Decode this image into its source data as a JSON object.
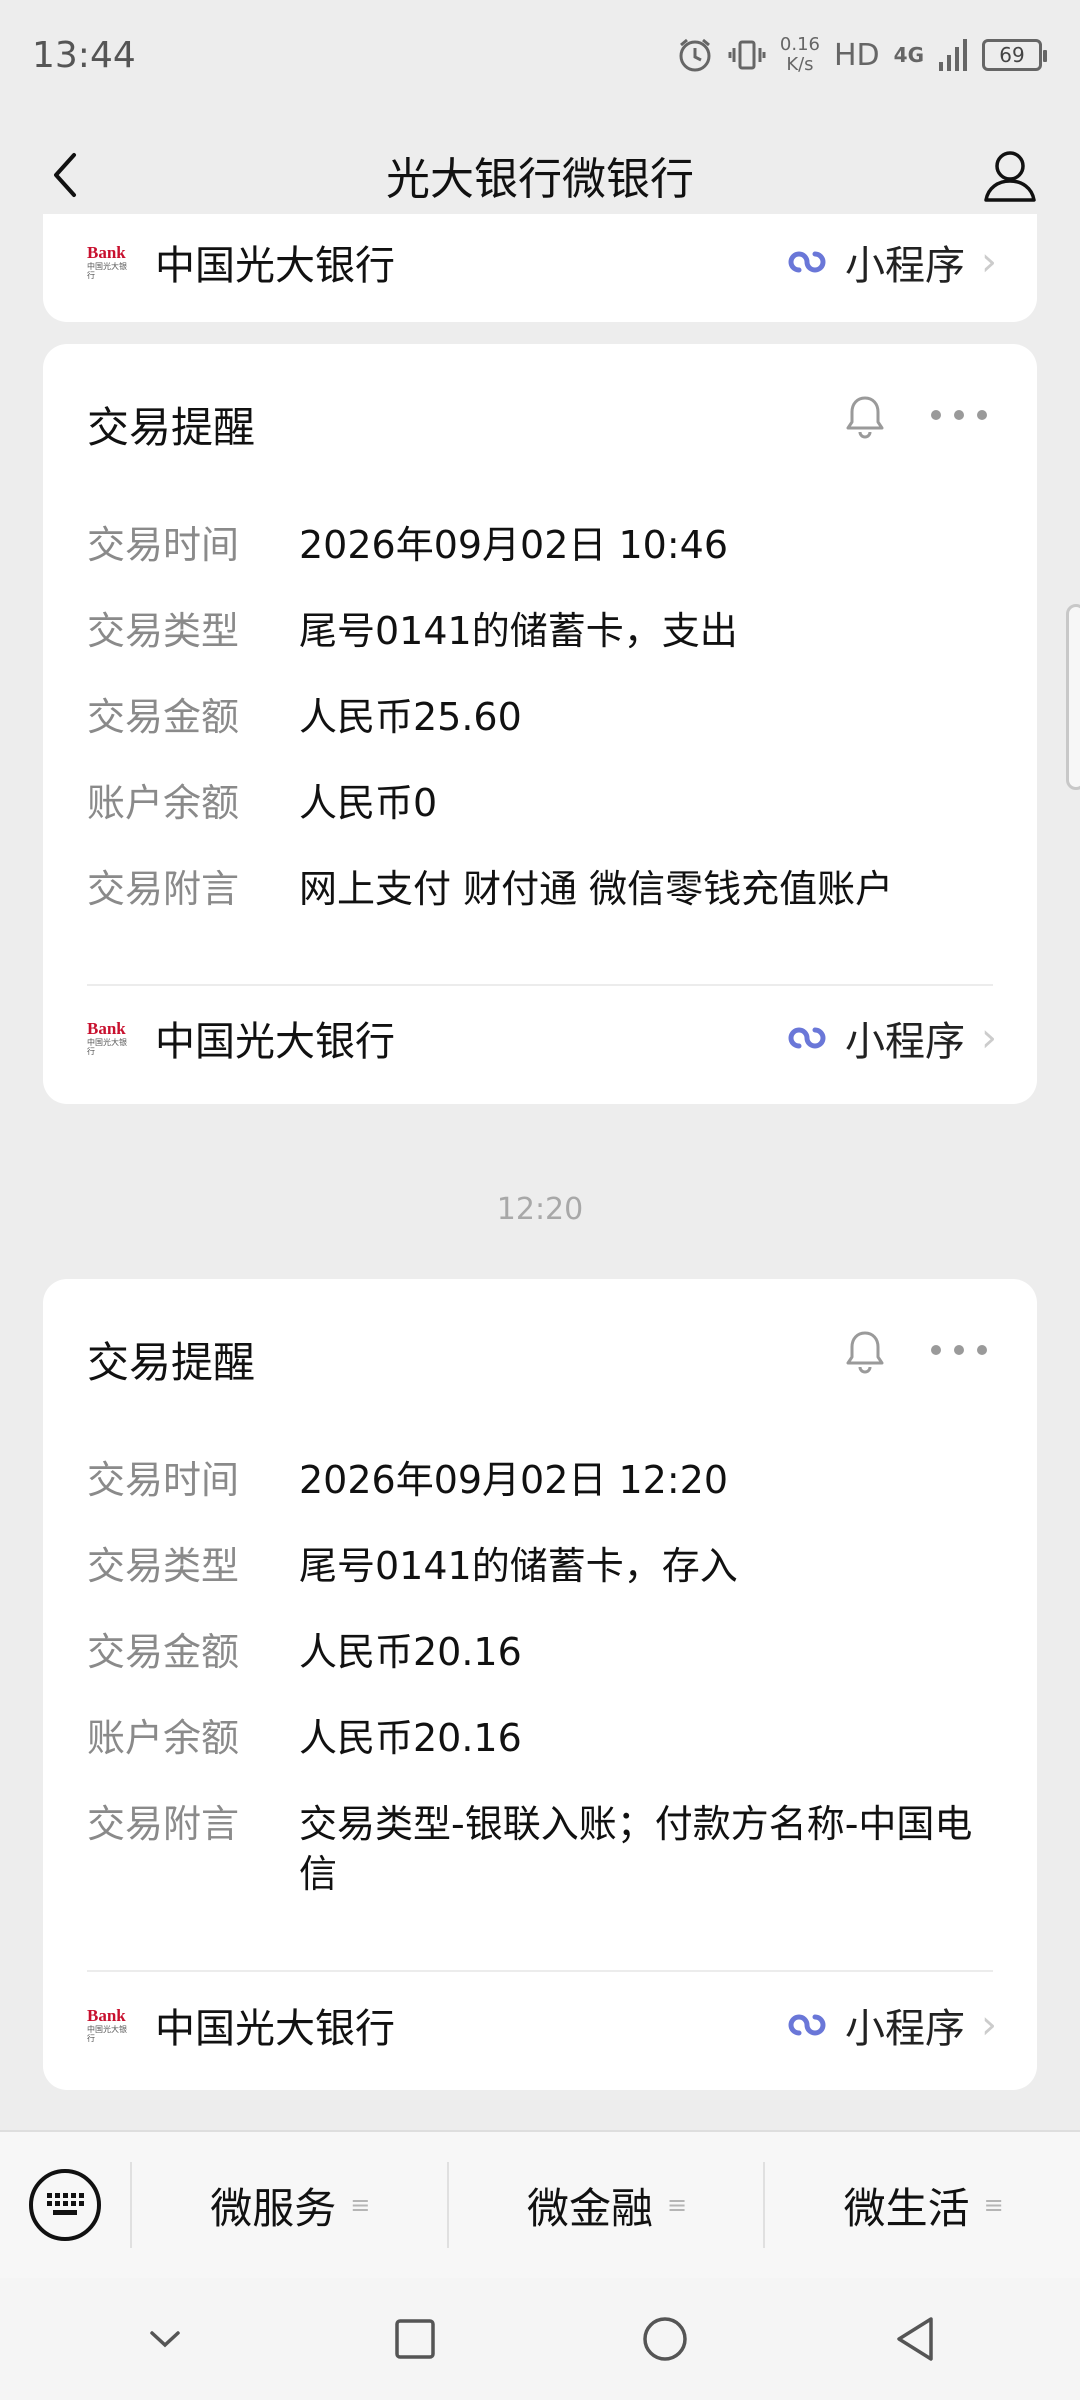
{
  "status_bar": {
    "time": "13:44",
    "net_speed_value": "0.16",
    "net_speed_unit": "K/s",
    "hd": "HD",
    "network": "4G",
    "battery": "69"
  },
  "nav": {
    "title": "光大银行微银行"
  },
  "partial_card": {
    "bank_name": "中国光大银行",
    "mini_program": "小程序"
  },
  "cards": [
    {
      "title": "交易提醒",
      "rows": [
        {
          "label": "交易时间",
          "value": "2026年09月02日 10:46"
        },
        {
          "label": "交易类型",
          "value": "尾号0141的储蓄卡，支出"
        },
        {
          "label": "交易金额",
          "value": "人民币25.60"
        },
        {
          "label": "账户余额",
          "value": "人民币0"
        },
        {
          "label": "交易附言",
          "value": "网上支付 财付通 微信零钱充值账户"
        }
      ],
      "bank_name": "中国光大银行",
      "mini_program": "小程序"
    },
    {
      "title": "交易提醒",
      "rows": [
        {
          "label": "交易时间",
          "value": "2026年09月02日 12:20"
        },
        {
          "label": "交易类型",
          "value": "尾号0141的储蓄卡，存入"
        },
        {
          "label": "交易金额",
          "value": "人民币20.16"
        },
        {
          "label": "账户余额",
          "value": "人民币20.16"
        },
        {
          "label": "交易附言",
          "value": "交易类型-银联入账；付款方名称-中国电信"
        }
      ],
      "bank_name": "中国光大银行",
      "mini_program": "小程序"
    }
  ],
  "timestamp": "12:20",
  "bank_logo": {
    "line1": "Bank",
    "line2": "中国光大银行"
  },
  "menu": {
    "items": [
      {
        "label": "微服务"
      },
      {
        "label": "微金融"
      },
      {
        "label": "微生活"
      }
    ]
  },
  "icons": {
    "back": "chevron-left-icon",
    "profile": "user-icon",
    "bell": "bell-icon",
    "more": "more-icon",
    "mini_program": "mini-program-link-icon",
    "keyboard": "keyboard-icon"
  }
}
